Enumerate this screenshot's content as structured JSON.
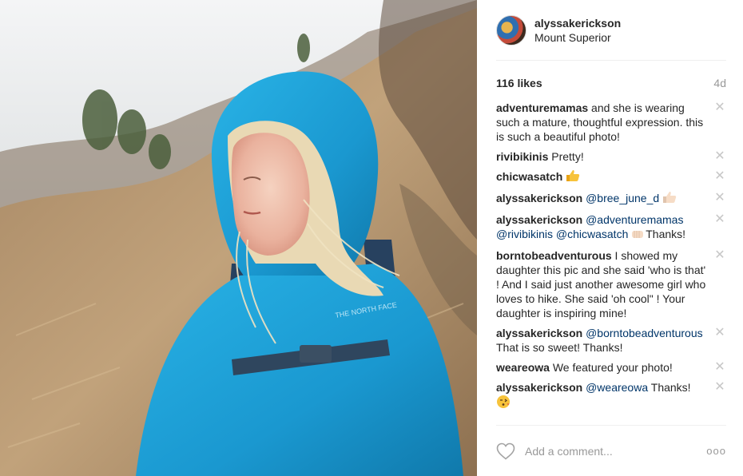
{
  "post": {
    "header": {
      "username": "alyssakerickson",
      "location": "Mount Superior"
    },
    "likes": "116 likes",
    "age": "4d",
    "comments": [
      {
        "author": "adventuremamas",
        "text": " and she is wearing such a mature, thoughtful expression. this is such a beautiful photo!"
      },
      {
        "author": "rivibikinis",
        "text": " Pretty!"
      },
      {
        "author": "chicwasatch",
        "text": " ",
        "emoji": "thumbs-up"
      },
      {
        "author": "alyssakerickson",
        "mention1": "@bree_june_d",
        "emoji": "thumbs-up-light"
      },
      {
        "author": "alyssakerickson",
        "mention1": "@adventuremamas",
        "mention2": "@rivibikinis",
        "mention3": "@chicwasatch",
        "text": "Thanks!",
        "emoji": "fist-bump"
      },
      {
        "author": "borntobeadventurous",
        "text": " I showed my daughter this pic and she said 'who is that' ! And I said just another awesome girl who loves to hike. She said 'oh cool\" ! Your daughter is inspiring mine!"
      },
      {
        "author": "alyssakerickson",
        "mention1": "@borntobeadventurous",
        "text": " That is so sweet! Thanks!"
      },
      {
        "author": "weareowa",
        "text": " We featured your photo!"
      },
      {
        "author": "alyssakerickson",
        "mention1": "@weareowa",
        "text": " Thanks!",
        "emoji": "kissing-face"
      }
    ],
    "footer": {
      "placeholder": "Add a comment...",
      "more_label": "ooo"
    },
    "icons": {
      "heart": "heart-icon",
      "close": "close-icon",
      "more": "more-options-icon"
    },
    "close_glyph": "✕",
    "colors": {
      "text": "#262626",
      "mention": "#003569",
      "muted": "#999999",
      "jacket": "#1ea0d6"
    }
  }
}
